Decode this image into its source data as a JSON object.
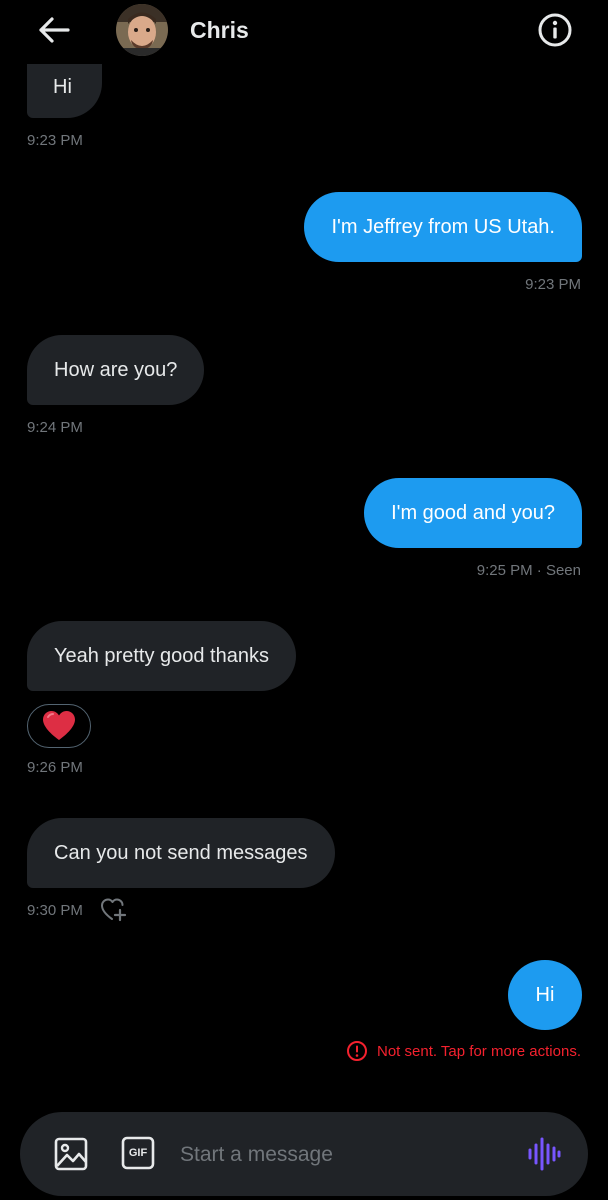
{
  "header": {
    "contact_name": "Chris",
    "back_icon": "arrow-left-icon",
    "info_icon": "info-circle-icon"
  },
  "messages": [
    {
      "direction": "in",
      "text": "Hi",
      "time": "9:23 PM"
    },
    {
      "direction": "out",
      "text": "I'm Jeffrey from US Utah.",
      "time": "9:23 PM"
    },
    {
      "direction": "in",
      "text": "How are you?",
      "time": "9:24 PM"
    },
    {
      "direction": "out",
      "text": "I'm good and you?",
      "time": "9:25 PM · Seen"
    },
    {
      "direction": "in",
      "text": "Yeah pretty good thanks",
      "reaction": "❤️",
      "time": "9:26 PM"
    },
    {
      "direction": "in",
      "text": "Can you not send messages",
      "time": "9:30 PM"
    },
    {
      "direction": "out",
      "text": "Hi",
      "status": "Not sent. Tap for more actions."
    }
  ],
  "composer": {
    "placeholder": "Start a message",
    "gif_label": "GIF",
    "media_icon": "image-icon",
    "voice_icon": "voice-waveform-icon"
  },
  "colors": {
    "background": "#000000",
    "bubble_incoming": "#202327",
    "bubble_outgoing": "#1d9bf0",
    "meta_text": "#71767b",
    "error": "#f4212e",
    "voice_accent": "#7856ff",
    "heart": "#e0245e"
  }
}
